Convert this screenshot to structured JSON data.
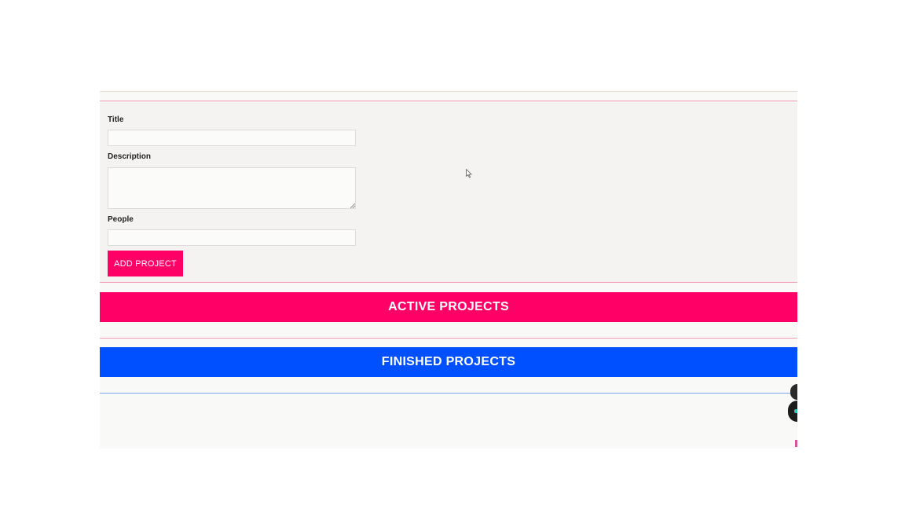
{
  "form": {
    "title_label": "Title",
    "title_value": "",
    "description_label": "Description",
    "description_value": "",
    "people_label": "People",
    "people_value": "",
    "submit_label": "ADD PROJECT"
  },
  "sections": {
    "active_title": "ACTIVE PROJECTS",
    "finished_title": "FINISHED PROJECTS"
  },
  "colors": {
    "accent_pink": "#ff0066",
    "accent_blue": "#0050ff"
  },
  "icons": {
    "cursor": "mouse-pointer-icon",
    "floating_1": "floating-action-icon",
    "floating_2": "chat-widget-icon"
  }
}
